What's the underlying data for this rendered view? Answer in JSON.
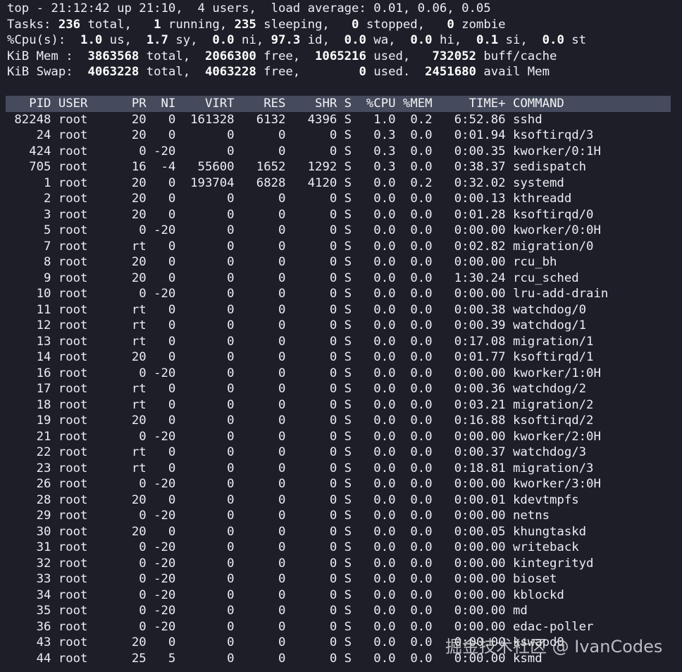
{
  "summary": {
    "uptime": {
      "prefix": "top - ",
      "time": "21:12:42",
      "up": " up 21:10,  ",
      "users": "4 users,  ",
      "load": "load average: 0.01, 0.06, 0.05"
    },
    "tasks": {
      "label": "Tasks: ",
      "total": "236",
      "total_l": " total,   ",
      "running": "1",
      "running_l": " running, ",
      "sleeping": "235",
      "sleeping_l": " sleeping,   ",
      "stopped": "0",
      "stopped_l": " stopped,   ",
      "zombie": "0",
      "zombie_l": " zombie"
    },
    "cpu": {
      "label": "%Cpu(s):  ",
      "us": "1.0",
      "us_l": " us,  ",
      "sy": "1.7",
      "sy_l": " sy,  ",
      "ni": "0.0",
      "ni_l": " ni, ",
      "id": "97.3",
      "id_l": " id,  ",
      "wa": "0.0",
      "wa_l": " wa,  ",
      "hi": "0.0",
      "hi_l": " hi,  ",
      "si": "0.1",
      "si_l": " si,  ",
      "st": "0.0",
      "st_l": " st"
    },
    "mem": {
      "label": "KiB Mem :  ",
      "total": "3863568",
      "total_l": " total,  ",
      "free": "2066300",
      "free_l": " free,  ",
      "used": "1065216",
      "used_l": " used,   ",
      "buff": "732052",
      "buff_l": " buff/cache"
    },
    "swap": {
      "label": "KiB Swap:  ",
      "total": "4063228",
      "total_l": " total,  ",
      "free": "4063228",
      "free_l": " free,        ",
      "used": "0",
      "used_l": " used.  ",
      "avail": "2451680",
      "avail_l": " avail Mem"
    }
  },
  "columns": [
    "PID",
    "USER",
    "PR",
    "NI",
    "VIRT",
    "RES",
    "SHR",
    "S",
    "%CPU",
    "%MEM",
    "TIME+",
    "COMMAND"
  ],
  "processes": [
    [
      "82248",
      "root",
      "20",
      "0",
      "161328",
      "6132",
      "4396",
      "S",
      "1.0",
      "0.2",
      "6:52.86",
      "sshd"
    ],
    [
      "24",
      "root",
      "20",
      "0",
      "0",
      "0",
      "0",
      "S",
      "0.3",
      "0.0",
      "0:01.94",
      "ksoftirqd/3"
    ],
    [
      "424",
      "root",
      "0",
      "-20",
      "0",
      "0",
      "0",
      "S",
      "0.3",
      "0.0",
      "0:00.35",
      "kworker/0:1H"
    ],
    [
      "705",
      "root",
      "16",
      "-4",
      "55600",
      "1652",
      "1292",
      "S",
      "0.3",
      "0.0",
      "0:38.37",
      "sedispatch"
    ],
    [
      "1",
      "root",
      "20",
      "0",
      "193704",
      "6828",
      "4120",
      "S",
      "0.0",
      "0.2",
      "0:32.02",
      "systemd"
    ],
    [
      "2",
      "root",
      "20",
      "0",
      "0",
      "0",
      "0",
      "S",
      "0.0",
      "0.0",
      "0:00.13",
      "kthreadd"
    ],
    [
      "3",
      "root",
      "20",
      "0",
      "0",
      "0",
      "0",
      "S",
      "0.0",
      "0.0",
      "0:01.28",
      "ksoftirqd/0"
    ],
    [
      "5",
      "root",
      "0",
      "-20",
      "0",
      "0",
      "0",
      "S",
      "0.0",
      "0.0",
      "0:00.00",
      "kworker/0:0H"
    ],
    [
      "7",
      "root",
      "rt",
      "0",
      "0",
      "0",
      "0",
      "S",
      "0.0",
      "0.0",
      "0:02.82",
      "migration/0"
    ],
    [
      "8",
      "root",
      "20",
      "0",
      "0",
      "0",
      "0",
      "S",
      "0.0",
      "0.0",
      "0:00.00",
      "rcu_bh"
    ],
    [
      "9",
      "root",
      "20",
      "0",
      "0",
      "0",
      "0",
      "S",
      "0.0",
      "0.0",
      "1:30.24",
      "rcu_sched"
    ],
    [
      "10",
      "root",
      "0",
      "-20",
      "0",
      "0",
      "0",
      "S",
      "0.0",
      "0.0",
      "0:00.00",
      "lru-add-drain"
    ],
    [
      "11",
      "root",
      "rt",
      "0",
      "0",
      "0",
      "0",
      "S",
      "0.0",
      "0.0",
      "0:00.38",
      "watchdog/0"
    ],
    [
      "12",
      "root",
      "rt",
      "0",
      "0",
      "0",
      "0",
      "S",
      "0.0",
      "0.0",
      "0:00.39",
      "watchdog/1"
    ],
    [
      "13",
      "root",
      "rt",
      "0",
      "0",
      "0",
      "0",
      "S",
      "0.0",
      "0.0",
      "0:17.08",
      "migration/1"
    ],
    [
      "14",
      "root",
      "20",
      "0",
      "0",
      "0",
      "0",
      "S",
      "0.0",
      "0.0",
      "0:01.77",
      "ksoftirqd/1"
    ],
    [
      "16",
      "root",
      "0",
      "-20",
      "0",
      "0",
      "0",
      "S",
      "0.0",
      "0.0",
      "0:00.00",
      "kworker/1:0H"
    ],
    [
      "17",
      "root",
      "rt",
      "0",
      "0",
      "0",
      "0",
      "S",
      "0.0",
      "0.0",
      "0:00.36",
      "watchdog/2"
    ],
    [
      "18",
      "root",
      "rt",
      "0",
      "0",
      "0",
      "0",
      "S",
      "0.0",
      "0.0",
      "0:03.21",
      "migration/2"
    ],
    [
      "19",
      "root",
      "20",
      "0",
      "0",
      "0",
      "0",
      "S",
      "0.0",
      "0.0",
      "0:16.88",
      "ksoftirqd/2"
    ],
    [
      "21",
      "root",
      "0",
      "-20",
      "0",
      "0",
      "0",
      "S",
      "0.0",
      "0.0",
      "0:00.00",
      "kworker/2:0H"
    ],
    [
      "22",
      "root",
      "rt",
      "0",
      "0",
      "0",
      "0",
      "S",
      "0.0",
      "0.0",
      "0:00.37",
      "watchdog/3"
    ],
    [
      "23",
      "root",
      "rt",
      "0",
      "0",
      "0",
      "0",
      "S",
      "0.0",
      "0.0",
      "0:18.81",
      "migration/3"
    ],
    [
      "26",
      "root",
      "0",
      "-20",
      "0",
      "0",
      "0",
      "S",
      "0.0",
      "0.0",
      "0:00.00",
      "kworker/3:0H"
    ],
    [
      "28",
      "root",
      "20",
      "0",
      "0",
      "0",
      "0",
      "S",
      "0.0",
      "0.0",
      "0:00.01",
      "kdevtmpfs"
    ],
    [
      "29",
      "root",
      "0",
      "-20",
      "0",
      "0",
      "0",
      "S",
      "0.0",
      "0.0",
      "0:00.00",
      "netns"
    ],
    [
      "30",
      "root",
      "20",
      "0",
      "0",
      "0",
      "0",
      "S",
      "0.0",
      "0.0",
      "0:00.05",
      "khungtaskd"
    ],
    [
      "31",
      "root",
      "0",
      "-20",
      "0",
      "0",
      "0",
      "S",
      "0.0",
      "0.0",
      "0:00.00",
      "writeback"
    ],
    [
      "32",
      "root",
      "0",
      "-20",
      "0",
      "0",
      "0",
      "S",
      "0.0",
      "0.0",
      "0:00.00",
      "kintegrityd"
    ],
    [
      "33",
      "root",
      "0",
      "-20",
      "0",
      "0",
      "0",
      "S",
      "0.0",
      "0.0",
      "0:00.00",
      "bioset"
    ],
    [
      "34",
      "root",
      "0",
      "-20",
      "0",
      "0",
      "0",
      "S",
      "0.0",
      "0.0",
      "0:00.00",
      "kblockd"
    ],
    [
      "35",
      "root",
      "0",
      "-20",
      "0",
      "0",
      "0",
      "S",
      "0.0",
      "0.0",
      "0:00.00",
      "md"
    ],
    [
      "36",
      "root",
      "0",
      "-20",
      "0",
      "0",
      "0",
      "S",
      "0.0",
      "0.0",
      "0:00.00",
      "edac-poller"
    ],
    [
      "43",
      "root",
      "20",
      "0",
      "0",
      "0",
      "0",
      "S",
      "0.0",
      "0.0",
      "0:00.00",
      "kswapd0"
    ],
    [
      "44",
      "root",
      "25",
      "5",
      "0",
      "0",
      "0",
      "S",
      "0.0",
      "0.0",
      "0:00.00",
      "ksmd"
    ]
  ],
  "watermark": "掘金技术社区 @ IvanCodes",
  "colors": {
    "background": "#1d1e28",
    "header_bar": "#454a5c",
    "text": "#eceef2"
  }
}
